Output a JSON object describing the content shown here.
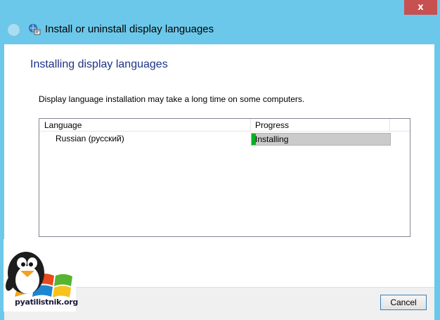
{
  "window": {
    "title": "Install or uninstall display languages",
    "close_glyph": "x"
  },
  "page": {
    "heading": "Installing display languages",
    "description": "Display language installation may take a long time on some computers."
  },
  "list": {
    "columns": [
      "Language",
      "Progress"
    ],
    "rows": [
      {
        "language": "Russian (русский)",
        "status": "Installing",
        "progress_fraction": 0.03
      }
    ]
  },
  "footer": {
    "cancel_label": "Cancel"
  },
  "watermark": {
    "text": "pyatilistnik.org"
  },
  "colors": {
    "titlebar": "#6cc8ea",
    "heading": "#1e3287",
    "progress_fill": "#06b025",
    "close_button": "#c75050"
  }
}
